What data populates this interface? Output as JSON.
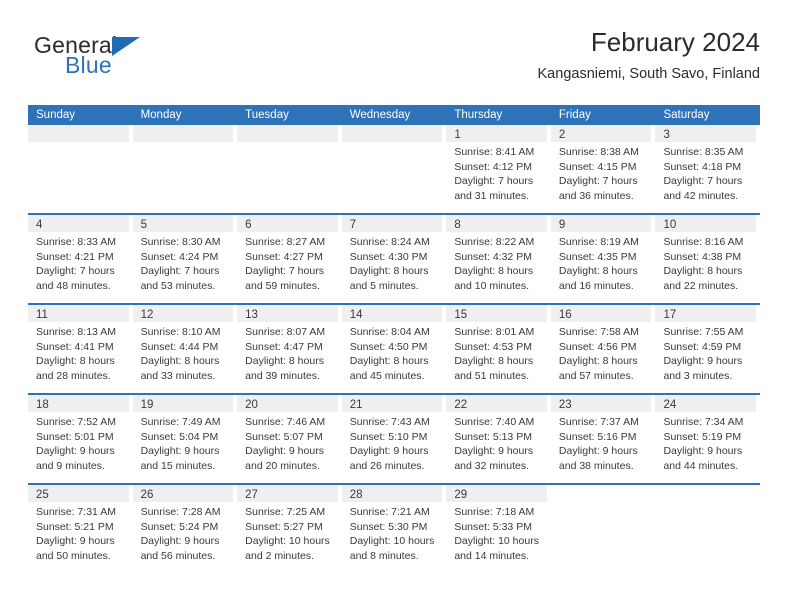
{
  "brand": {
    "name_part1": "General",
    "name_part2": "Blue",
    "logo_icon": "triangle-flag-icon"
  },
  "header": {
    "title": "February 2024",
    "location": "Kangasniemi, South Savo, Finland"
  },
  "colors": {
    "header_blue": "#2e72b8",
    "date_strip_gray": "#efefef",
    "text": "#3a3a3a",
    "background": "#ffffff"
  },
  "weekday_headers": [
    "Sunday",
    "Monday",
    "Tuesday",
    "Wednesday",
    "Thursday",
    "Friday",
    "Saturday"
  ],
  "weeks": [
    [
      {
        "day": "",
        "sunrise": "",
        "sunset": "",
        "daylight_line1": "",
        "daylight_line2": "",
        "empty": true
      },
      {
        "day": "",
        "sunrise": "",
        "sunset": "",
        "daylight_line1": "",
        "daylight_line2": "",
        "empty": true
      },
      {
        "day": "",
        "sunrise": "",
        "sunset": "",
        "daylight_line1": "",
        "daylight_line2": "",
        "empty": true
      },
      {
        "day": "",
        "sunrise": "",
        "sunset": "",
        "daylight_line1": "",
        "daylight_line2": "",
        "empty": true
      },
      {
        "day": "1",
        "sunrise": "Sunrise: 8:41 AM",
        "sunset": "Sunset: 4:12 PM",
        "daylight_line1": "Daylight: 7 hours",
        "daylight_line2": "and 31 minutes."
      },
      {
        "day": "2",
        "sunrise": "Sunrise: 8:38 AM",
        "sunset": "Sunset: 4:15 PM",
        "daylight_line1": "Daylight: 7 hours",
        "daylight_line2": "and 36 minutes."
      },
      {
        "day": "3",
        "sunrise": "Sunrise: 8:35 AM",
        "sunset": "Sunset: 4:18 PM",
        "daylight_line1": "Daylight: 7 hours",
        "daylight_line2": "and 42 minutes."
      }
    ],
    [
      {
        "day": "4",
        "sunrise": "Sunrise: 8:33 AM",
        "sunset": "Sunset: 4:21 PM",
        "daylight_line1": "Daylight: 7 hours",
        "daylight_line2": "and 48 minutes."
      },
      {
        "day": "5",
        "sunrise": "Sunrise: 8:30 AM",
        "sunset": "Sunset: 4:24 PM",
        "daylight_line1": "Daylight: 7 hours",
        "daylight_line2": "and 53 minutes."
      },
      {
        "day": "6",
        "sunrise": "Sunrise: 8:27 AM",
        "sunset": "Sunset: 4:27 PM",
        "daylight_line1": "Daylight: 7 hours",
        "daylight_line2": "and 59 minutes."
      },
      {
        "day": "7",
        "sunrise": "Sunrise: 8:24 AM",
        "sunset": "Sunset: 4:30 PM",
        "daylight_line1": "Daylight: 8 hours",
        "daylight_line2": "and 5 minutes."
      },
      {
        "day": "8",
        "sunrise": "Sunrise: 8:22 AM",
        "sunset": "Sunset: 4:32 PM",
        "daylight_line1": "Daylight: 8 hours",
        "daylight_line2": "and 10 minutes."
      },
      {
        "day": "9",
        "sunrise": "Sunrise: 8:19 AM",
        "sunset": "Sunset: 4:35 PM",
        "daylight_line1": "Daylight: 8 hours",
        "daylight_line2": "and 16 minutes."
      },
      {
        "day": "10",
        "sunrise": "Sunrise: 8:16 AM",
        "sunset": "Sunset: 4:38 PM",
        "daylight_line1": "Daylight: 8 hours",
        "daylight_line2": "and 22 minutes."
      }
    ],
    [
      {
        "day": "11",
        "sunrise": "Sunrise: 8:13 AM",
        "sunset": "Sunset: 4:41 PM",
        "daylight_line1": "Daylight: 8 hours",
        "daylight_line2": "and 28 minutes."
      },
      {
        "day": "12",
        "sunrise": "Sunrise: 8:10 AM",
        "sunset": "Sunset: 4:44 PM",
        "daylight_line1": "Daylight: 8 hours",
        "daylight_line2": "and 33 minutes."
      },
      {
        "day": "13",
        "sunrise": "Sunrise: 8:07 AM",
        "sunset": "Sunset: 4:47 PM",
        "daylight_line1": "Daylight: 8 hours",
        "daylight_line2": "and 39 minutes."
      },
      {
        "day": "14",
        "sunrise": "Sunrise: 8:04 AM",
        "sunset": "Sunset: 4:50 PM",
        "daylight_line1": "Daylight: 8 hours",
        "daylight_line2": "and 45 minutes."
      },
      {
        "day": "15",
        "sunrise": "Sunrise: 8:01 AM",
        "sunset": "Sunset: 4:53 PM",
        "daylight_line1": "Daylight: 8 hours",
        "daylight_line2": "and 51 minutes."
      },
      {
        "day": "16",
        "sunrise": "Sunrise: 7:58 AM",
        "sunset": "Sunset: 4:56 PM",
        "daylight_line1": "Daylight: 8 hours",
        "daylight_line2": "and 57 minutes."
      },
      {
        "day": "17",
        "sunrise": "Sunrise: 7:55 AM",
        "sunset": "Sunset: 4:59 PM",
        "daylight_line1": "Daylight: 9 hours",
        "daylight_line2": "and 3 minutes."
      }
    ],
    [
      {
        "day": "18",
        "sunrise": "Sunrise: 7:52 AM",
        "sunset": "Sunset: 5:01 PM",
        "daylight_line1": "Daylight: 9 hours",
        "daylight_line2": "and 9 minutes."
      },
      {
        "day": "19",
        "sunrise": "Sunrise: 7:49 AM",
        "sunset": "Sunset: 5:04 PM",
        "daylight_line1": "Daylight: 9 hours",
        "daylight_line2": "and 15 minutes."
      },
      {
        "day": "20",
        "sunrise": "Sunrise: 7:46 AM",
        "sunset": "Sunset: 5:07 PM",
        "daylight_line1": "Daylight: 9 hours",
        "daylight_line2": "and 20 minutes."
      },
      {
        "day": "21",
        "sunrise": "Sunrise: 7:43 AM",
        "sunset": "Sunset: 5:10 PM",
        "daylight_line1": "Daylight: 9 hours",
        "daylight_line2": "and 26 minutes."
      },
      {
        "day": "22",
        "sunrise": "Sunrise: 7:40 AM",
        "sunset": "Sunset: 5:13 PM",
        "daylight_line1": "Daylight: 9 hours",
        "daylight_line2": "and 32 minutes."
      },
      {
        "day": "23",
        "sunrise": "Sunrise: 7:37 AM",
        "sunset": "Sunset: 5:16 PM",
        "daylight_line1": "Daylight: 9 hours",
        "daylight_line2": "and 38 minutes."
      },
      {
        "day": "24",
        "sunrise": "Sunrise: 7:34 AM",
        "sunset": "Sunset: 5:19 PM",
        "daylight_line1": "Daylight: 9 hours",
        "daylight_line2": "and 44 minutes."
      }
    ],
    [
      {
        "day": "25",
        "sunrise": "Sunrise: 7:31 AM",
        "sunset": "Sunset: 5:21 PM",
        "daylight_line1": "Daylight: 9 hours",
        "daylight_line2": "and 50 minutes."
      },
      {
        "day": "26",
        "sunrise": "Sunrise: 7:28 AM",
        "sunset": "Sunset: 5:24 PM",
        "daylight_line1": "Daylight: 9 hours",
        "daylight_line2": "and 56 minutes."
      },
      {
        "day": "27",
        "sunrise": "Sunrise: 7:25 AM",
        "sunset": "Sunset: 5:27 PM",
        "daylight_line1": "Daylight: 10 hours",
        "daylight_line2": "and 2 minutes."
      },
      {
        "day": "28",
        "sunrise": "Sunrise: 7:21 AM",
        "sunset": "Sunset: 5:30 PM",
        "daylight_line1": "Daylight: 10 hours",
        "daylight_line2": "and 8 minutes."
      },
      {
        "day": "29",
        "sunrise": "Sunrise: 7:18 AM",
        "sunset": "Sunset: 5:33 PM",
        "daylight_line1": "Daylight: 10 hours",
        "daylight_line2": "and 14 minutes."
      },
      {
        "day": "",
        "sunrise": "",
        "sunset": "",
        "daylight_line1": "",
        "daylight_line2": "",
        "empty": true,
        "nostrip": true
      },
      {
        "day": "",
        "sunrise": "",
        "sunset": "",
        "daylight_line1": "",
        "daylight_line2": "",
        "empty": true,
        "nostrip": true
      }
    ]
  ]
}
